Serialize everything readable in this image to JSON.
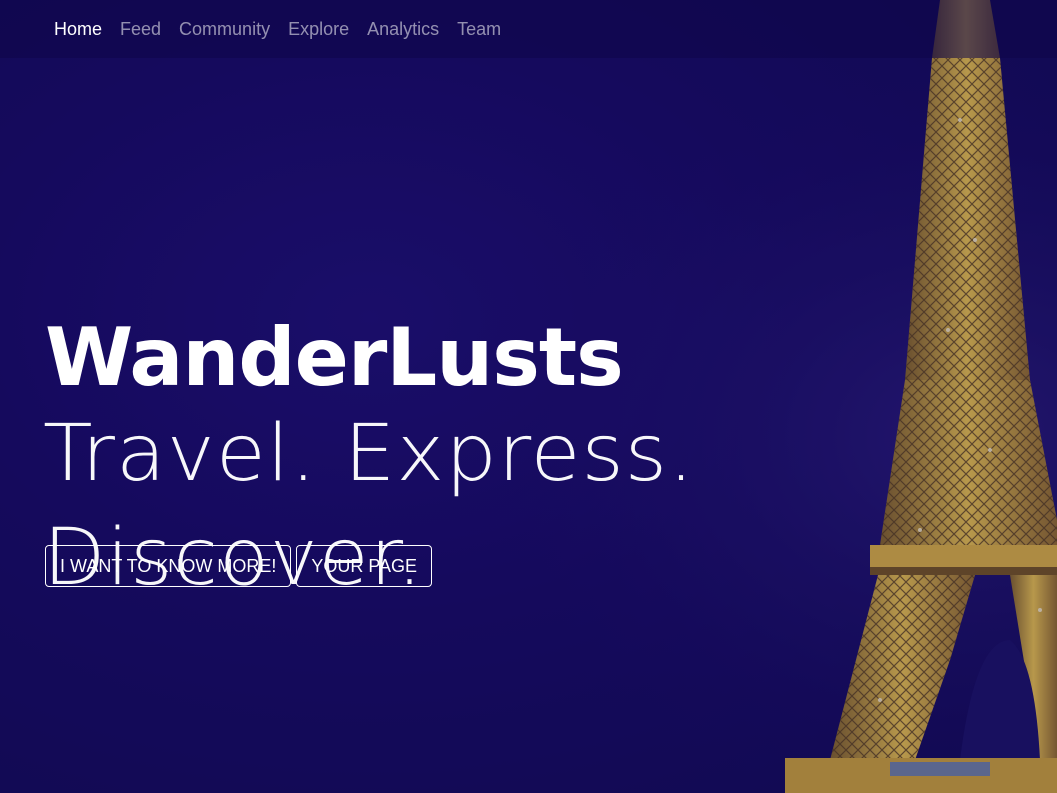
{
  "nav": {
    "items": [
      {
        "label": "Home",
        "active": true
      },
      {
        "label": "Feed",
        "active": false
      },
      {
        "label": "Community",
        "active": false
      },
      {
        "label": "Explore",
        "active": false
      },
      {
        "label": "Analytics",
        "active": false
      },
      {
        "label": "Team",
        "active": false
      }
    ]
  },
  "hero": {
    "title": "WanderLusts",
    "tagline": "Travel. Express. Discover.",
    "buttons": {
      "know_more": "I WANT TO KNOW MORE!",
      "your_page": "YOUR PAGE"
    },
    "background_image": "eiffel-tower-night-photo",
    "overlay_color": "#150a5c",
    "tower_light_color": "#f0c23a"
  }
}
